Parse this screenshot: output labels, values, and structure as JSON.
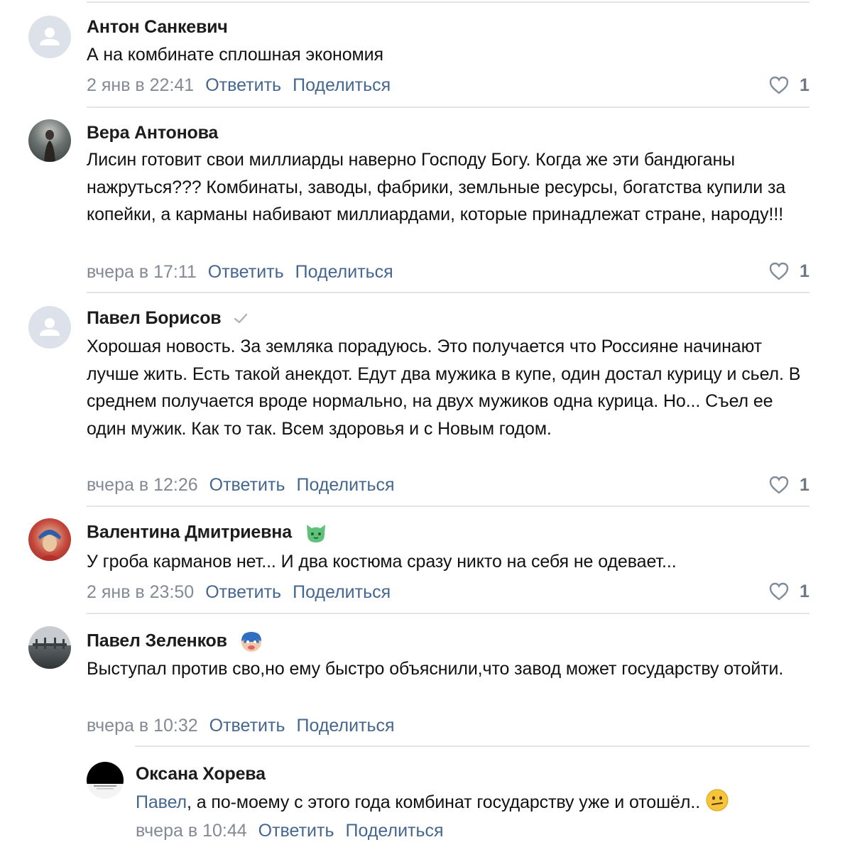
{
  "comments": [
    {
      "author": "Антон Санкевич",
      "text": "А на комбинате сплошная экономия",
      "time": "2 янв в 22:41",
      "reply_label": "Ответить",
      "share_label": "Поделиться",
      "likes": "1"
    },
    {
      "author": "Вера Антонова",
      "text": "Лисин готовит свои миллиарды наверно Господу Богу. Когда же эти бандюганы нажруться??? Комбинаты, заводы, фабрики, земльные ресурсы, богатства купили за копейки, а карманы набивают миллиардами, которые принадлежат стране, народу!!!",
      "time": "вчера в 17:11",
      "reply_label": "Ответить",
      "share_label": "Поделиться",
      "likes": "1"
    },
    {
      "author": "Павел Борисов",
      "text": "Хорошая новость. За земляка порадуюсь. Это получается что Россияне начинают лучше жить. Есть такой анекдот. Едут два мужика в купе, один достал курицу и сьел. В среднем получается вроде нормально, на двух мужиков одна курица. Но... Съел ее один мужик. Как то так. Всем здоровья и с Новым годом.",
      "time": "вчера в 12:26",
      "reply_label": "Ответить",
      "share_label": "Поделиться",
      "likes": "1"
    },
    {
      "author": "Валентина Дмитриевна",
      "text": "У гроба карманов нет... И два костюма сразу никто на себя не одевает...",
      "time": "2 янв в 23:50",
      "reply_label": "Ответить",
      "share_label": "Поделиться",
      "likes": "1"
    },
    {
      "author": "Павел Зеленков",
      "text": "Выступал против сво,но ему быстро объяснили,что завод может государству отойти.",
      "time": "вчера в 10:32",
      "reply_label": "Ответить",
      "share_label": "Поделиться",
      "likes": ""
    },
    {
      "author": "Оксана Хорева",
      "mention": "Павел",
      "text": ", а по-моему с этого года комбинат государству уже и отошёл..",
      "time": "вчера в 10:44",
      "reply_label": "Ответить",
      "share_label": "Поделиться",
      "likes": ""
    }
  ],
  "colors": {
    "link": "#45678f",
    "meta": "#848a94",
    "divider": "#e3e4e8",
    "avatar_placeholder": "#dde2ea"
  }
}
